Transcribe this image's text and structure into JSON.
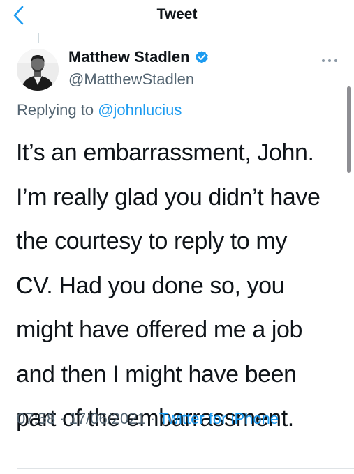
{
  "header": {
    "title": "Tweet",
    "back_icon": "chevron-left-icon"
  },
  "author": {
    "name": "Matthew Stadlen",
    "handle": "@MatthewStadlen",
    "verified": true,
    "verified_icon": "verified-badge-icon"
  },
  "reply": {
    "prefix": "Replying to ",
    "handle": "@johnlucius"
  },
  "tweet": {
    "lines": [
      "It’s an embarrassment, John.",
      "I’m really glad you didn’t have",
      "the courtesy to reply to my",
      "CV. Had you done so, you",
      "might have offered me a job",
      "and then I might have been",
      "part of the embarrassment."
    ]
  },
  "meta": {
    "time": "07:58",
    "separator": " · ",
    "date": "17/06/2021",
    "source": "Twitter for iPhone"
  },
  "colors": {
    "accent": "#1d9bf0",
    "text_primary": "#0f1419",
    "text_secondary": "#536471",
    "divider": "#dfe3e6"
  }
}
